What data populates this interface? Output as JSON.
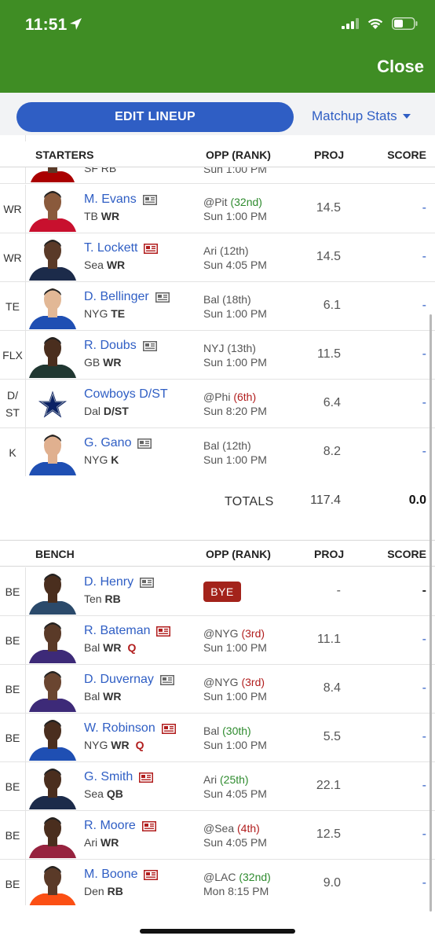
{
  "status_bar": {
    "time": "11:51"
  },
  "header": {
    "close_label": "Close"
  },
  "toolbar": {
    "edit_label": "EDIT LINEUP",
    "matchup_label": "Matchup Stats"
  },
  "starters_header": {
    "section": "STARTERS",
    "opp": "OPP (RANK)",
    "proj": "PROJ",
    "score": "SCORE"
  },
  "partial_row": {
    "team": "SF RB",
    "opp_time": "Sun 1:00 PM"
  },
  "starters": [
    {
      "slot": "WR",
      "name": "M. Evans",
      "team": "TB",
      "pos": "WR",
      "inj": "",
      "opp": "@Pit",
      "rank": "(32nd)",
      "rank_color": "green",
      "time": "Sun 1:00 PM",
      "proj": "14.5",
      "score": "-",
      "news": "grey",
      "jersey": "#c8102e",
      "skin": "#8a5a3c"
    },
    {
      "slot": "WR",
      "name": "T. Lockett",
      "team": "Sea",
      "pos": "WR",
      "inj": "",
      "opp": "Ari",
      "rank": "(12th)",
      "rank_color": "grey",
      "time": "Sun 4:05 PM",
      "proj": "14.5",
      "score": "-",
      "news": "red",
      "jersey": "#1c2b4a",
      "skin": "#5a3a28"
    },
    {
      "slot": "TE",
      "name": "D. Bellinger",
      "team": "NYG",
      "pos": "TE",
      "inj": "",
      "opp": "Bal",
      "rank": "(18th)",
      "rank_color": "grey",
      "time": "Sun 1:00 PM",
      "proj": "6.1",
      "score": "-",
      "news": "grey",
      "jersey": "#1f4fb3",
      "skin": "#e2b896"
    },
    {
      "slot": "FLX",
      "name": "R. Doubs",
      "team": "GB",
      "pos": "WR",
      "inj": "",
      "opp": "NYJ",
      "rank": "(13th)",
      "rank_color": "grey",
      "time": "Sun 1:00 PM",
      "proj": "11.5",
      "score": "-",
      "news": "grey",
      "jersey": "#203731",
      "skin": "#4a2e1e"
    },
    {
      "slot": "D/ST",
      "name": "Cowboys D/ST",
      "team": "Dal",
      "pos": "D/ST",
      "inj": "",
      "opp": "@Phi",
      "rank": "(6th)",
      "rank_color": "red",
      "time": "Sun 8:20 PM",
      "proj": "6.4",
      "score": "-",
      "news": "none",
      "jersey": "",
      "skin": ""
    },
    {
      "slot": "K",
      "name": "G. Gano",
      "team": "NYG",
      "pos": "K",
      "inj": "",
      "opp": "Bal",
      "rank": "(12th)",
      "rank_color": "grey",
      "time": "Sun 1:00 PM",
      "proj": "8.2",
      "score": "-",
      "news": "grey",
      "jersey": "#1f4fb3",
      "skin": "#e0b08f"
    }
  ],
  "totals": {
    "label": "TOTALS",
    "proj": "117.4",
    "score": "0.0"
  },
  "bench_header": {
    "section": "BENCH",
    "opp": "OPP (RANK)",
    "proj": "PROJ",
    "score": "SCORE"
  },
  "bench": [
    {
      "slot": "BE",
      "name": "D. Henry",
      "team": "Ten",
      "pos": "RB",
      "inj": "",
      "bye": "BYE",
      "opp": "",
      "rank": "",
      "rank_color": "grey",
      "time": "",
      "proj": "-",
      "score": "-",
      "news": "grey",
      "jersey": "#2b4a6b",
      "skin": "#4a2e1e"
    },
    {
      "slot": "BE",
      "name": "R. Bateman",
      "team": "Bal",
      "pos": "WR",
      "inj": "Q",
      "bye": "",
      "opp": "@NYG",
      "rank": "(3rd)",
      "rank_color": "red",
      "time": "Sun 1:00 PM",
      "proj": "11.1",
      "score": "-",
      "news": "red",
      "jersey": "#3d2a78",
      "skin": "#5a3a28"
    },
    {
      "slot": "BE",
      "name": "D. Duvernay",
      "team": "Bal",
      "pos": "WR",
      "inj": "",
      "bye": "",
      "opp": "@NYG",
      "rank": "(3rd)",
      "rank_color": "red",
      "time": "Sun 1:00 PM",
      "proj": "8.4",
      "score": "-",
      "news": "grey",
      "jersey": "#3d2a78",
      "skin": "#6a4530"
    },
    {
      "slot": "BE",
      "name": "W. Robinson",
      "team": "NYG",
      "pos": "WR",
      "inj": "Q",
      "bye": "",
      "opp": "Bal",
      "rank": "(30th)",
      "rank_color": "green",
      "time": "Sun 1:00 PM",
      "proj": "5.5",
      "score": "-",
      "news": "red",
      "jersey": "#1f4fb3",
      "skin": "#4a2e1e"
    },
    {
      "slot": "BE",
      "name": "G. Smith",
      "team": "Sea",
      "pos": "QB",
      "inj": "",
      "bye": "",
      "opp": "Ari",
      "rank": "(25th)",
      "rank_color": "green",
      "time": "Sun 4:05 PM",
      "proj": "22.1",
      "score": "-",
      "news": "red",
      "jersey": "#1c2b4a",
      "skin": "#4a2e1e"
    },
    {
      "slot": "BE",
      "name": "R. Moore",
      "team": "Ari",
      "pos": "WR",
      "inj": "",
      "bye": "",
      "opp": "@Sea",
      "rank": "(4th)",
      "rank_color": "red",
      "time": "Sun 4:05 PM",
      "proj": "12.5",
      "score": "-",
      "news": "red",
      "jersey": "#97233f",
      "skin": "#4a2e1e"
    },
    {
      "slot": "BE",
      "name": "M. Boone",
      "team": "Den",
      "pos": "RB",
      "inj": "",
      "bye": "",
      "opp": "@LAC",
      "rank": "(32nd)",
      "rank_color": "green",
      "time": "Mon 8:15 PM",
      "proj": "9.0",
      "score": "-",
      "news": "red",
      "jersey": "#fb4f14",
      "skin": "#5a3a28"
    }
  ]
}
